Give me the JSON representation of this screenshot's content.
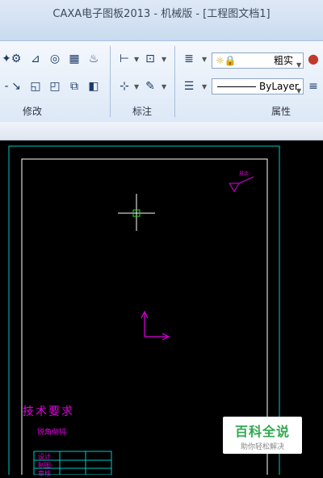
{
  "window": {
    "title": "CAXA电子图板2013 - 机械版 - [工程图文档1]"
  },
  "ribbon": {
    "groups": [
      {
        "label": "修改"
      },
      {
        "label": "标注"
      },
      {
        "label": "属性"
      }
    ],
    "linewidth_value": "粗实",
    "linetype_value": "ByLayer"
  },
  "drawing": {
    "tech_requirements_title": "技术要求",
    "tech_requirements_item": "锐角倒钝",
    "roughness_label": "其余",
    "title_block": [
      "设计",
      "制图",
      "审核"
    ]
  },
  "watermark": {
    "line1": "百科全说",
    "line2": "助你轻松解决"
  },
  "colors": {
    "frame_outer": "#00c8c8",
    "frame_inner": "#ffffff",
    "annotation": "#e000e0",
    "cursor": "#22dd22"
  }
}
